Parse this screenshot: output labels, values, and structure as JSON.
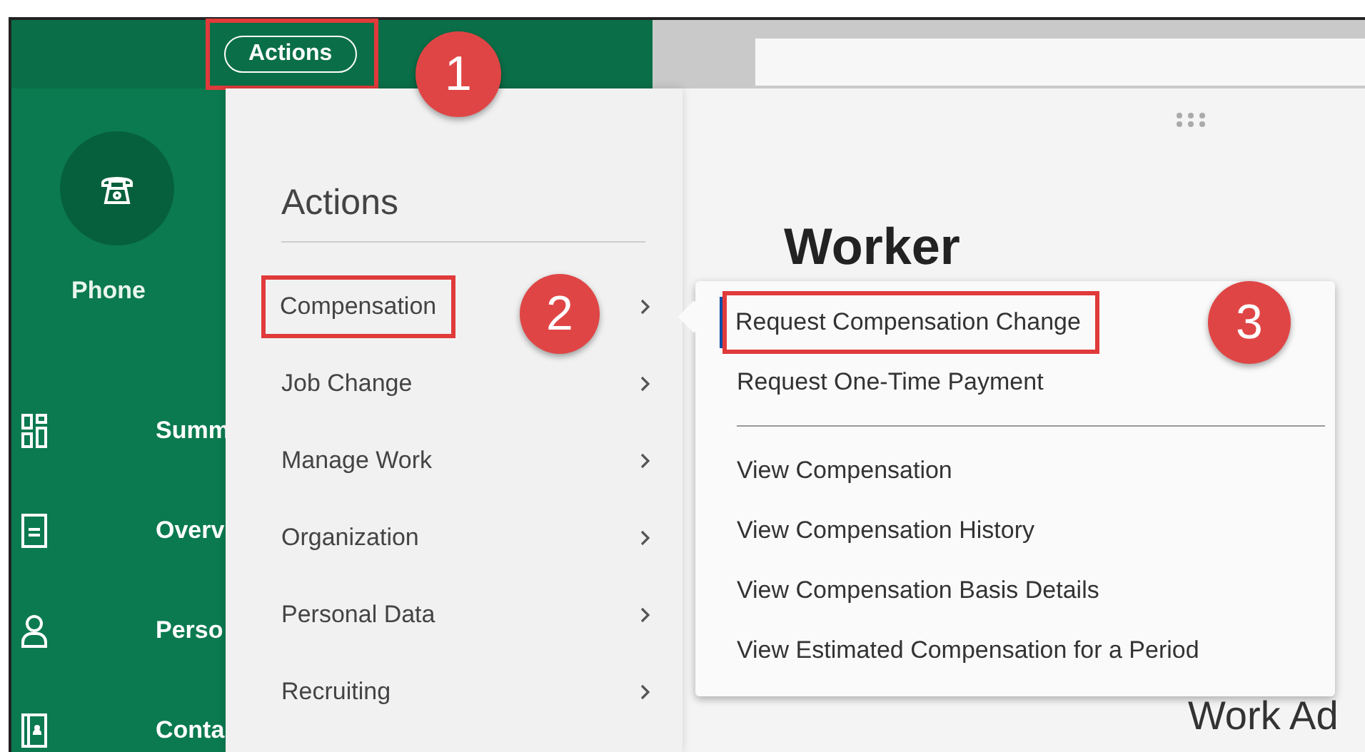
{
  "top_bar": {
    "actions_button": {
      "label": "Actions",
      "highlighted": true
    }
  },
  "sidebar": {
    "profile_action": {
      "label": "Phone"
    },
    "items": [
      {
        "label": "Summ",
        "kind": "grid"
      },
      {
        "label": "Overv",
        "kind": "document"
      },
      {
        "label": "Perso",
        "kind": "person"
      },
      {
        "label": "Conta",
        "kind": "contact"
      }
    ]
  },
  "actions_menu": {
    "title": "Actions",
    "items": [
      {
        "label": "Compensation",
        "highlighted": true
      },
      {
        "label": "Job Change",
        "highlighted": false
      },
      {
        "label": "Manage Work",
        "highlighted": false
      },
      {
        "label": "Organization",
        "highlighted": false
      },
      {
        "label": "Personal Data",
        "highlighted": false
      },
      {
        "label": "Recruiting",
        "highlighted": false
      }
    ]
  },
  "submenu": {
    "groups": [
      {
        "items": [
          {
            "label": "Request Compensation Change",
            "selected": true,
            "highlighted": true
          },
          {
            "label": "Request One-Time Payment",
            "selected": false,
            "highlighted": false
          }
        ]
      },
      {
        "items": [
          {
            "label": "View Compensation",
            "selected": false,
            "highlighted": false
          },
          {
            "label": "View Compensation History",
            "selected": false,
            "highlighted": false
          },
          {
            "label": "View Compensation Basis Details",
            "selected": false,
            "highlighted": false
          },
          {
            "label": "View Estimated Compensation for a Period",
            "selected": false,
            "highlighted": false
          }
        ]
      }
    ]
  },
  "page": {
    "heading": "Worker",
    "section_heading": "Work Ad"
  },
  "callouts": [
    {
      "number": "1"
    },
    {
      "number": "2"
    },
    {
      "number": "3"
    }
  ]
}
